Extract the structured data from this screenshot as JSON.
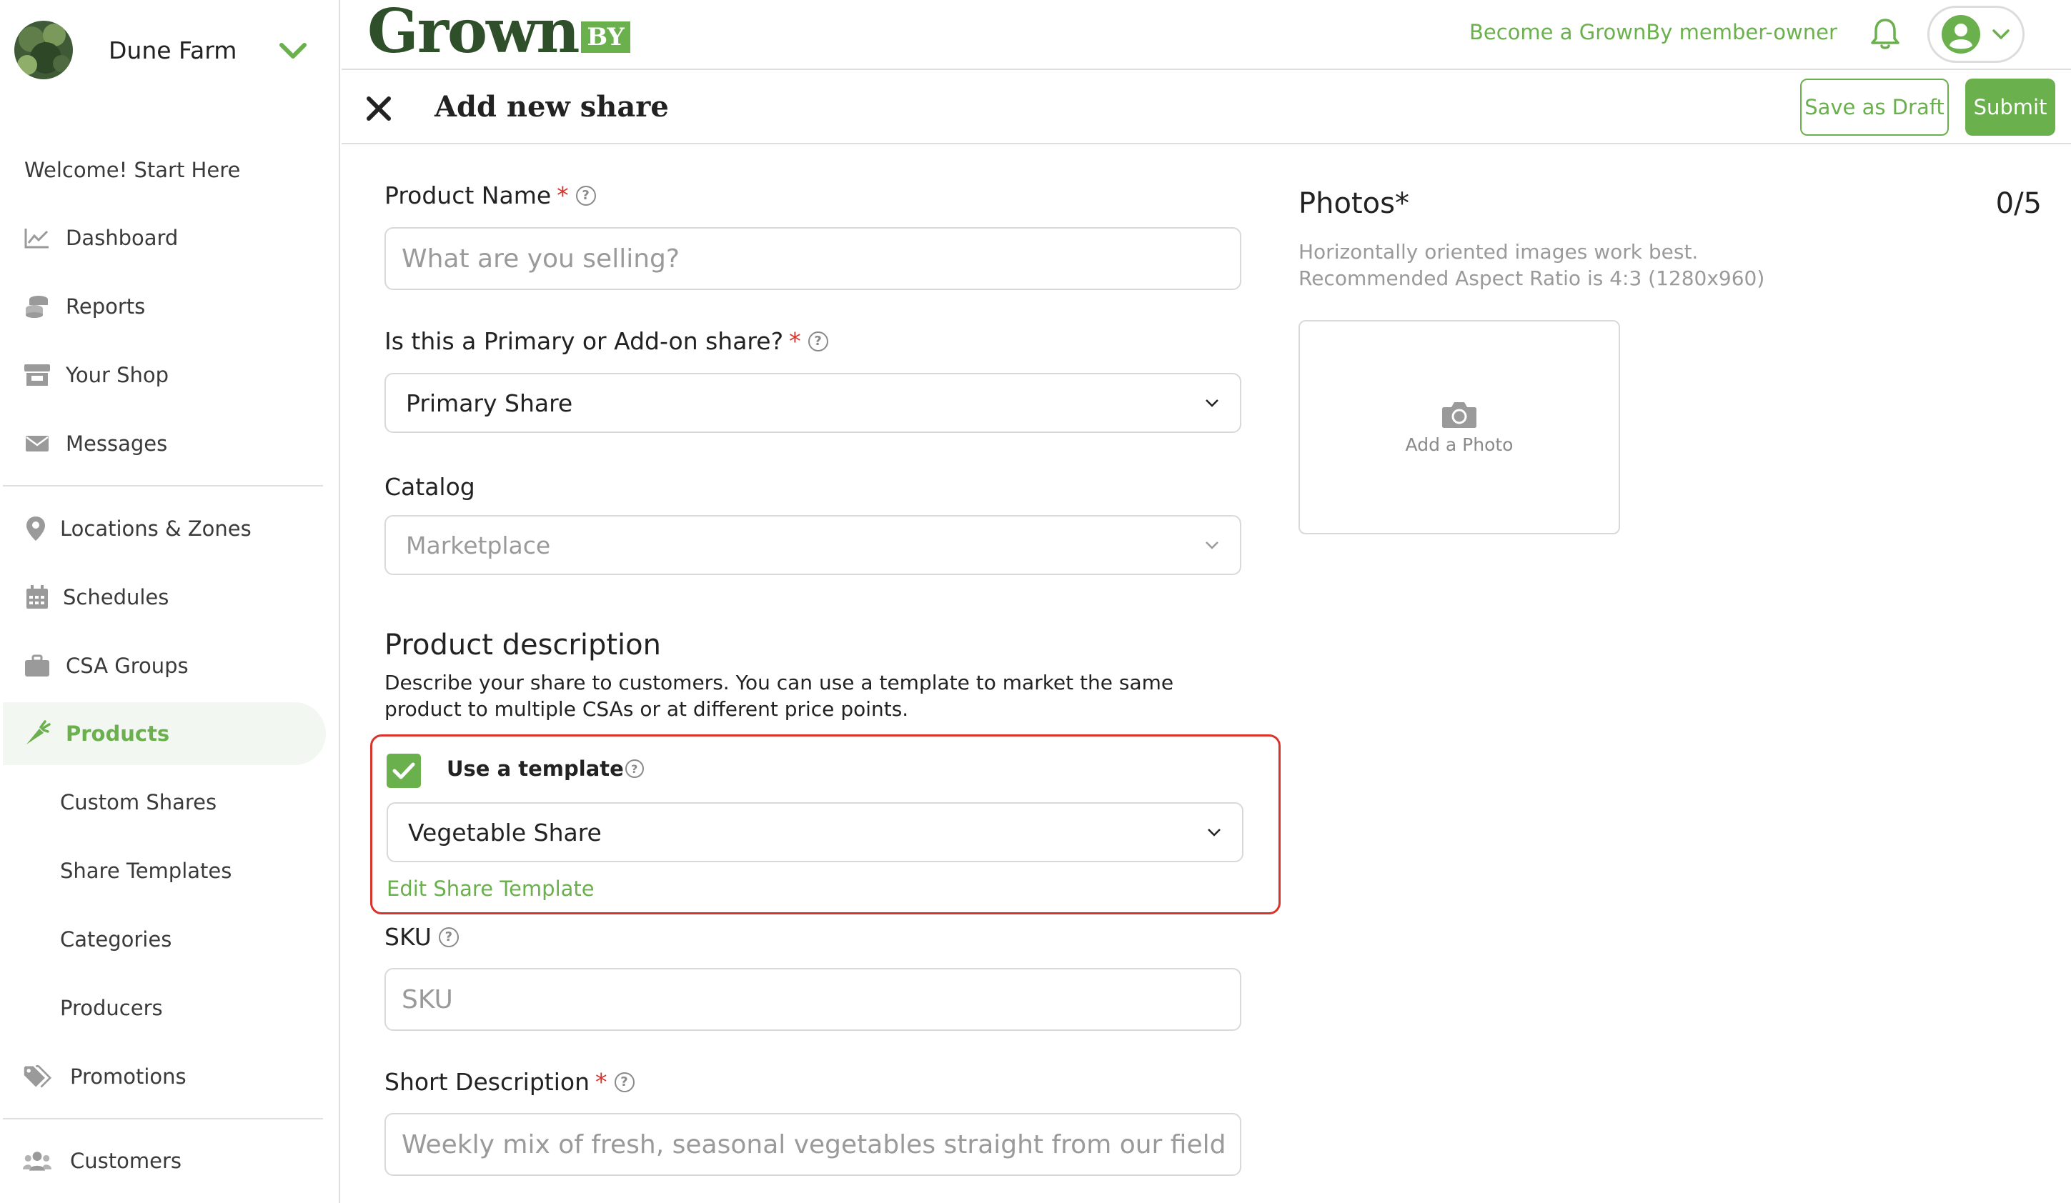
{
  "sidebar": {
    "farm_name": "Dune Farm",
    "welcome": "Welcome! Start Here",
    "items": {
      "dashboard": "Dashboard",
      "reports": "Reports",
      "your_shop": "Your Shop",
      "messages": "Messages",
      "locations": "Locations & Zones",
      "schedules": "Schedules",
      "csa_groups": "CSA Groups",
      "products": "Products",
      "custom_shares": "Custom Shares",
      "share_templates": "Share Templates",
      "categories": "Categories",
      "producers": "Producers",
      "promotions": "Promotions",
      "customers": "Customers"
    }
  },
  "topbar": {
    "logo_text": "Grown",
    "logo_badge": "BY",
    "member_link": "Become a GrownBy member-owner"
  },
  "header": {
    "title": "Add new share",
    "save_draft": "Save as Draft",
    "submit": "Submit"
  },
  "form": {
    "product_name": {
      "label": "Product Name",
      "required": "*",
      "placeholder": "What are you selling?"
    },
    "share_type": {
      "label": "Is this a Primary or Add-on share?",
      "required": "*",
      "value": "Primary Share"
    },
    "catalog": {
      "label": "Catalog",
      "value": "Marketplace"
    },
    "description": {
      "title": "Product description",
      "text": "Describe your share to customers. You can use a template to market the same product to multiple CSAs or at different price points."
    },
    "template": {
      "checkbox_label": "Use a template",
      "checked": true,
      "value": "Vegetable Share",
      "edit_link": "Edit Share Template"
    },
    "sku": {
      "label": "SKU",
      "placeholder": "SKU"
    },
    "short_description": {
      "label": "Short Description",
      "required": "*",
      "placeholder": "Weekly mix of fresh, seasonal vegetables straight from our fields"
    }
  },
  "photos": {
    "title": "Photos*",
    "count": "0/5",
    "hint_line1": "Horizontally oriented images work best.",
    "hint_line2": "Recommended Aspect Ratio is 4:3 (1280x960)",
    "add_label": "Add a Photo"
  },
  "colors": {
    "accent": "#6ab04c",
    "logo_dark": "#2f4f2a",
    "highlight_border": "#d9342b",
    "active_bg": "#f3f7f1"
  }
}
